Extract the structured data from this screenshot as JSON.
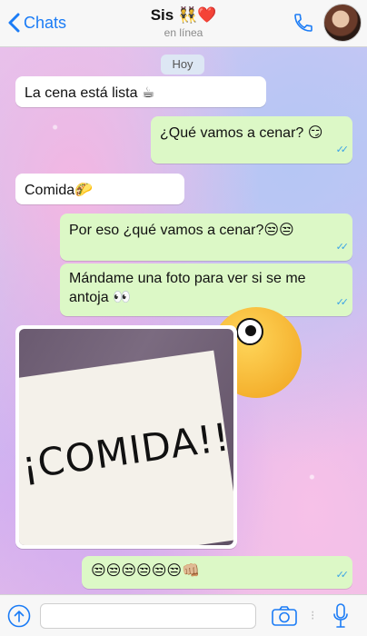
{
  "header": {
    "back_label": "Chats",
    "title": "Sis 👯❤️",
    "status": "en línea"
  },
  "chat": {
    "day_label": "Hoy",
    "messages": [
      {
        "dir": "in",
        "text": "La cena está lista ☕"
      },
      {
        "dir": "out",
        "text": "¿Qué vamos a cenar? 😏",
        "ticks": "✓✓"
      },
      {
        "dir": "in",
        "text": "Comida🌮"
      },
      {
        "dir": "out",
        "text": "Por eso ¿qué vamos a cenar?😒😒",
        "ticks": "✓✓"
      },
      {
        "dir": "out",
        "text": "Mándame una foto para ver si se me antoja 👀",
        "ticks": "✓✓"
      },
      {
        "dir": "in",
        "type": "image",
        "image_text": "¡COMIDA!!"
      },
      {
        "dir": "out",
        "text": "😒😒😒😒😒😒👊🏼",
        "ticks": "✓✓"
      }
    ]
  },
  "composer": {
    "placeholder": ""
  },
  "colors": {
    "accent": "#1b7cf6",
    "incoming_bubble": "#ffffff",
    "outgoing_bubble": "#dcf8c6",
    "read_ticks": "#3ba3e6"
  },
  "icons": {
    "back": "chevron-left-icon",
    "call": "phone-icon",
    "attach": "upload-icon",
    "camera": "camera-icon",
    "mic": "microphone-icon"
  }
}
